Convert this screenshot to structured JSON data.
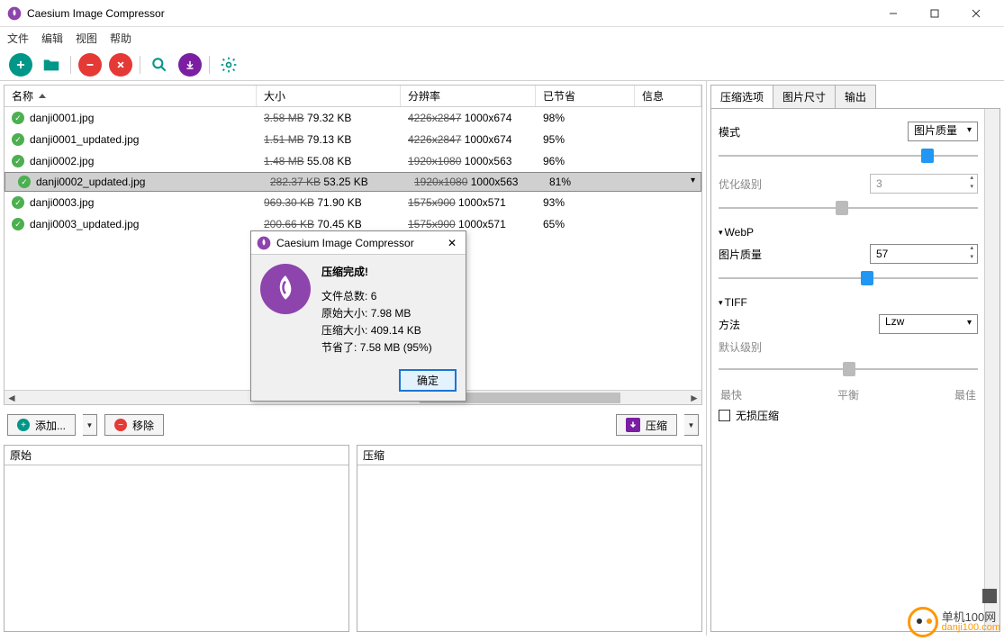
{
  "title": "Caesium Image Compressor",
  "menu": {
    "file": "文件",
    "edit": "编辑",
    "view": "视图",
    "help": "帮助"
  },
  "columns": {
    "name": "名称",
    "size": "大小",
    "res": "分辨率",
    "saved": "已节省",
    "info": "信息"
  },
  "rows": [
    {
      "name": "danji0001.jpg",
      "old_size": "3.58 MB",
      "new_size": "79.32 KB",
      "old_res": "4226x2847",
      "new_res": "1000x674",
      "saved": "98%",
      "selected": false
    },
    {
      "name": "danji0001_updated.jpg",
      "old_size": "1.51 MB",
      "new_size": "79.13 KB",
      "old_res": "4226x2847",
      "new_res": "1000x674",
      "saved": "95%",
      "selected": false
    },
    {
      "name": "danji0002.jpg",
      "old_size": "1.48 MB",
      "new_size": "55.08 KB",
      "old_res": "1920x1080",
      "new_res": "1000x563",
      "saved": "96%",
      "selected": false
    },
    {
      "name": "danji0002_updated.jpg",
      "old_size": "282.37 KB",
      "new_size": "53.25 KB",
      "old_res": "1920x1080",
      "new_res": "1000x563",
      "saved": "81%",
      "selected": true
    },
    {
      "name": "danji0003.jpg",
      "old_size": "969.30 KB",
      "new_size": "71.90 KB",
      "old_res": "1575x900",
      "new_res": "1000x571",
      "saved": "93%",
      "selected": false
    },
    {
      "name": "danji0003_updated.jpg",
      "old_size": "200.66 KB",
      "new_size": "70.45 KB",
      "old_res": "1575x900",
      "new_res": "1000x571",
      "saved": "65%",
      "selected": false
    }
  ],
  "buttons": {
    "add": "添加...",
    "remove": "移除",
    "compress": "压缩"
  },
  "preview": {
    "original": "原始",
    "compressed": "压缩"
  },
  "right": {
    "tabs": {
      "comp": "压缩选项",
      "size": "图片尺寸",
      "output": "输出"
    },
    "mode_label": "模式",
    "mode_value": "图片质量",
    "opt_level_label": "优化级别",
    "opt_level_value": "3",
    "webp_header": "WebP",
    "webp_quality_label": "图片质量",
    "webp_quality_value": "57",
    "tiff_header": "TIFF",
    "method_label": "方法",
    "method_value": "Lzw",
    "deflate_label": "默认级别",
    "ticks": {
      "fast": "最快",
      "balanced": "平衡",
      "best": "最佳"
    },
    "lossless": "无损压缩"
  },
  "dialog": {
    "title": "Caesium Image Compressor",
    "done": "压缩完成!",
    "total_files_label": "文件总数:",
    "total_files": "6",
    "orig_size_label": "原始大小:",
    "orig_size": "7.98 MB",
    "comp_size_label": "压缩大小:",
    "comp_size": "409.14 KB",
    "saved_label": "节省了:",
    "saved": "7.58 MB (95%)",
    "ok": "确定"
  },
  "watermark": {
    "l1": "单机100网",
    "l2": "danji100.com"
  }
}
